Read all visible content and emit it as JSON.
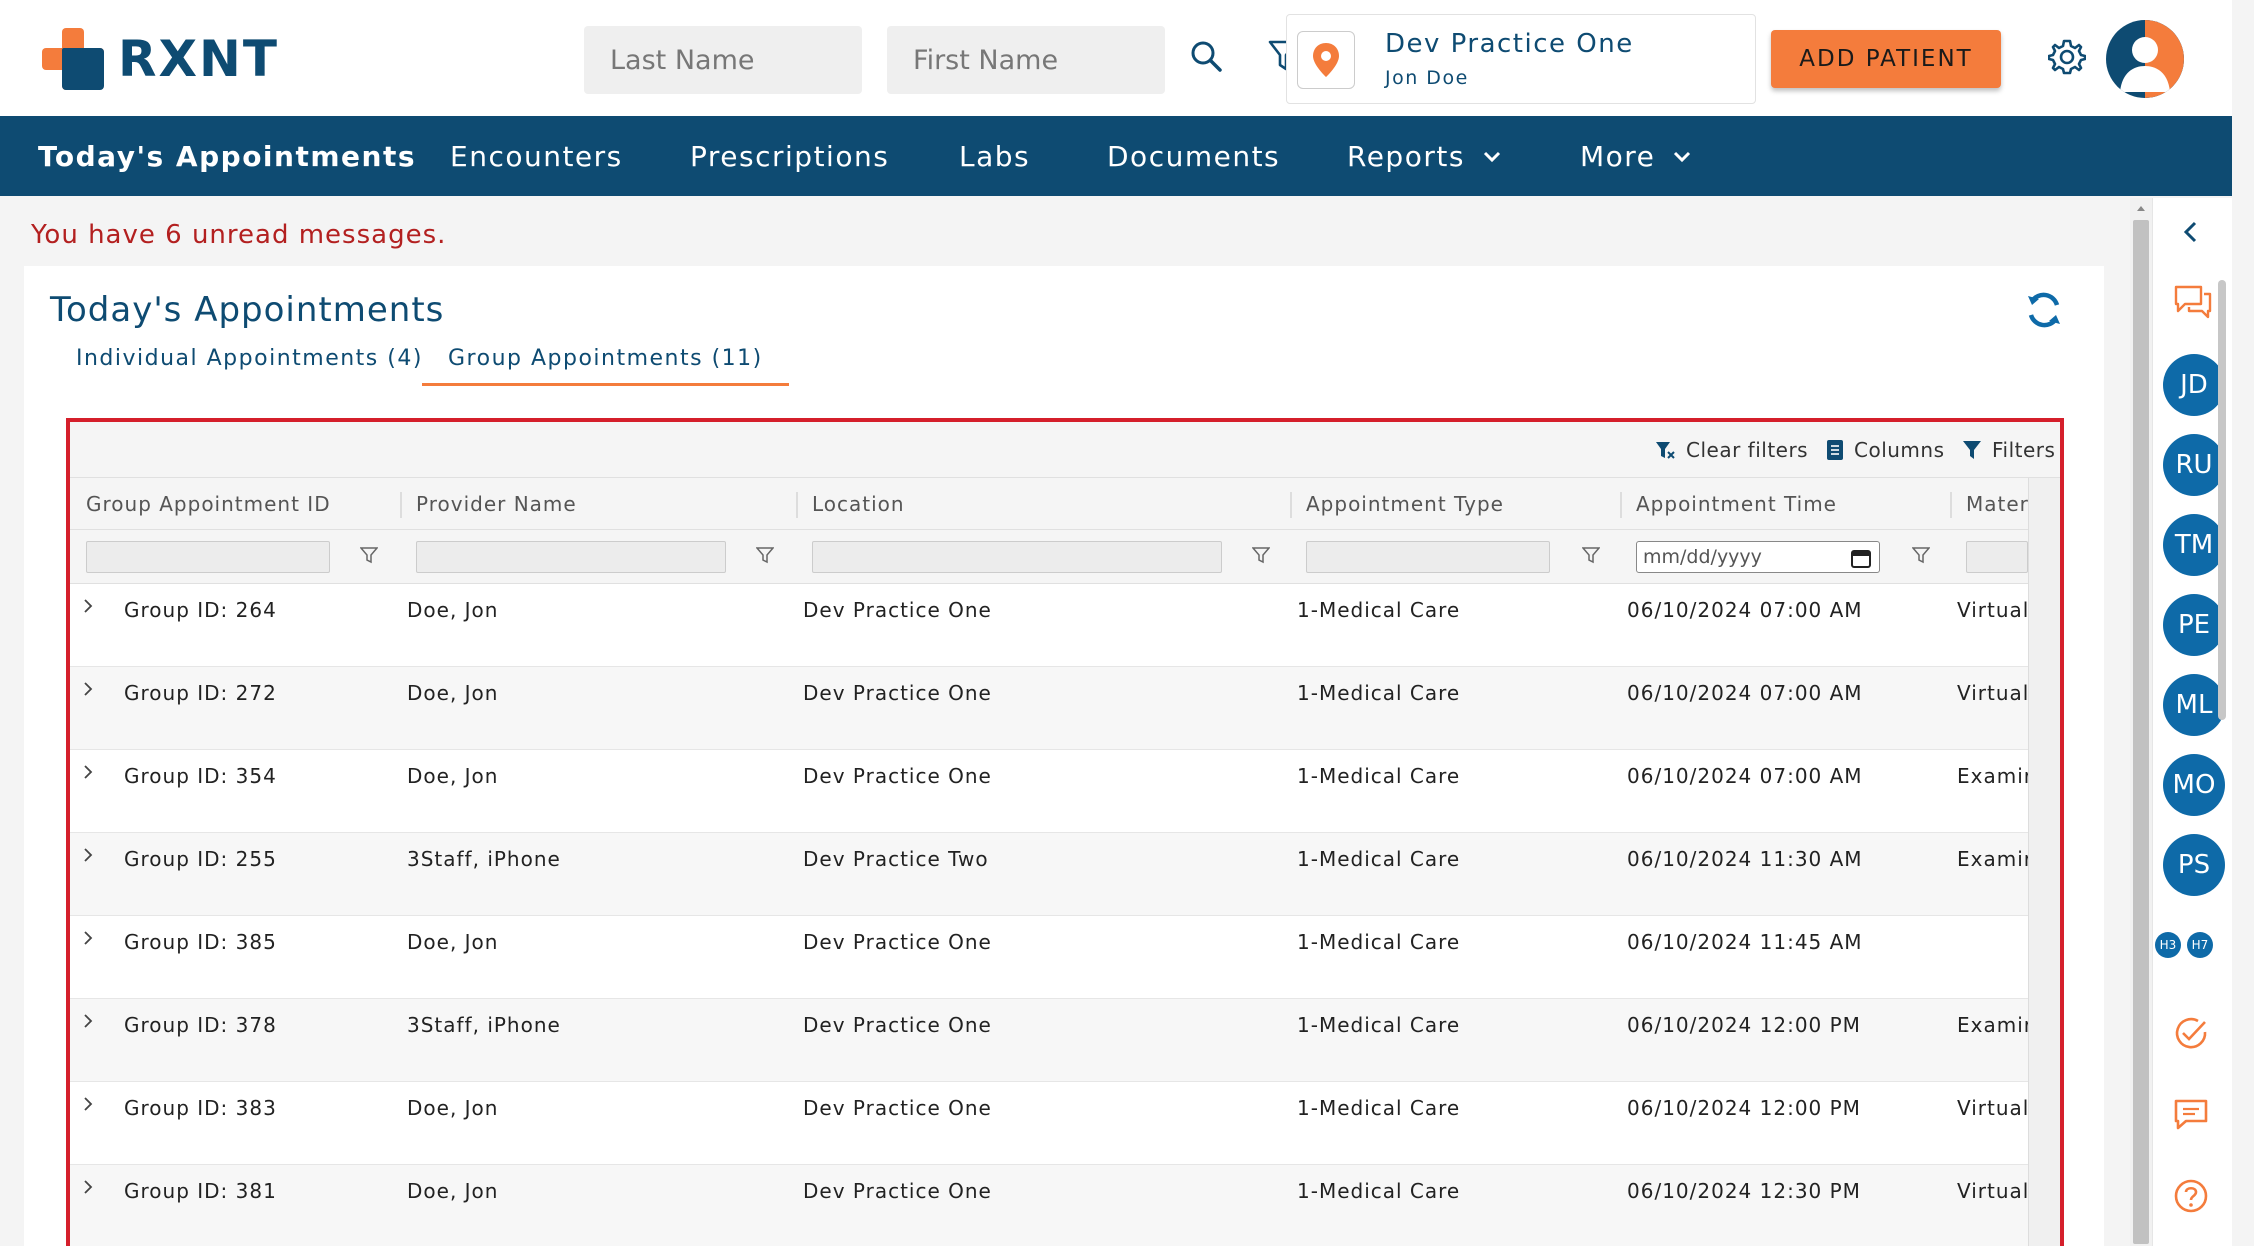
{
  "brand": {
    "name": "RXNT",
    "orange": "#f47c3c",
    "navy": "#0e4b72"
  },
  "search": {
    "last_name_placeholder": "Last Name",
    "first_name_placeholder": "First Name"
  },
  "practice": {
    "name": "Dev Practice One",
    "user": "Jon Doe"
  },
  "header": {
    "add_patient_label": "ADD PATIENT"
  },
  "nav": {
    "items": [
      {
        "label": "Today's Appointments",
        "active": true
      },
      {
        "label": "Encounters"
      },
      {
        "label": "Prescriptions"
      },
      {
        "label": "Labs"
      },
      {
        "label": "Documents"
      },
      {
        "label": "Reports",
        "dropdown": true
      },
      {
        "label": "More",
        "dropdown": true
      }
    ]
  },
  "messages": {
    "unread_text": "You have 6 unread messages."
  },
  "page": {
    "title": "Today's Appointments",
    "tabs": [
      {
        "label": "Individual Appointments (4)",
        "active": false
      },
      {
        "label": "Group Appointments (11)",
        "active": true
      }
    ]
  },
  "grid": {
    "toolbar": {
      "clear_filters": "Clear filters",
      "columns": "Columns",
      "filters": "Filters"
    },
    "columns": [
      "Group Appointment ID",
      "Provider Name",
      "Location",
      "Appointment Type",
      "Appointment Time",
      "Mater"
    ],
    "date_placeholder": "mm/dd/yyyy",
    "rows": [
      {
        "id": "Group ID: 264",
        "provider": "Doe, Jon",
        "location": "Dev Practice One",
        "type": "1-Medical Care",
        "time": "06/10/2024 07:00 AM",
        "material": "Virtual"
      },
      {
        "id": "Group ID: 272",
        "provider": "Doe, Jon",
        "location": "Dev Practice One",
        "type": "1-Medical Care",
        "time": "06/10/2024 07:00 AM",
        "material": "Virtual"
      },
      {
        "id": "Group ID: 354",
        "provider": "Doe, Jon",
        "location": "Dev Practice One",
        "type": "1-Medical Care",
        "time": "06/10/2024 07:00 AM",
        "material": "Examir"
      },
      {
        "id": "Group ID: 255",
        "provider": "3Staff, iPhone",
        "location": "Dev Practice Two",
        "type": "1-Medical Care",
        "time": "06/10/2024 11:30 AM",
        "material": "Examir"
      },
      {
        "id": "Group ID: 385",
        "provider": "Doe, Jon",
        "location": "Dev Practice One",
        "type": "1-Medical Care",
        "time": "06/10/2024 11:45 AM",
        "material": ""
      },
      {
        "id": "Group ID: 378",
        "provider": "3Staff, iPhone",
        "location": "Dev Practice One",
        "type": "1-Medical Care",
        "time": "06/10/2024 12:00 PM",
        "material": "Examir"
      },
      {
        "id": "Group ID: 383",
        "provider": "Doe, Jon",
        "location": "Dev Practice One",
        "type": "1-Medical Care",
        "time": "06/10/2024 12:00 PM",
        "material": "Virtual"
      },
      {
        "id": "Group ID: 381",
        "provider": "Doe, Jon",
        "location": "Dev Practice One",
        "type": "1-Medical Care",
        "time": "06/10/2024 12:30 PM",
        "material": "Virtual"
      }
    ]
  },
  "rail": {
    "avatars": [
      "JD",
      "RU",
      "TM",
      "PE",
      "ML",
      "MO",
      "PS"
    ],
    "mini": [
      "H3",
      "H7"
    ]
  }
}
